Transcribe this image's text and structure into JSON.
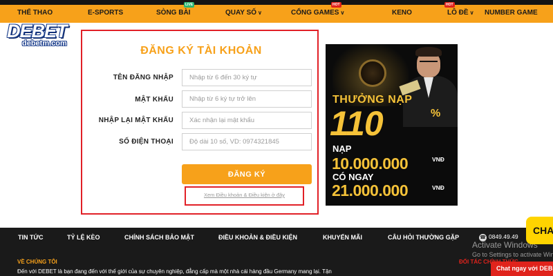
{
  "nav": {
    "items": [
      {
        "label": "THỂ THAO"
      },
      {
        "label": "E-SPORTS"
      },
      {
        "label": "SÒNG BÀI",
        "badge": "LIVE"
      },
      {
        "label": "QUAY SỐ",
        "caret": "∨"
      },
      {
        "label": "CỔNG GAMES",
        "badge": "HOT",
        "caret": "∨"
      },
      {
        "label": "KENO"
      },
      {
        "label": "LÔ ĐỀ",
        "badge": "HOT",
        "caret": "∨"
      },
      {
        "label": "NUMBER GAME"
      }
    ]
  },
  "logo": {
    "main": "DEBET",
    "sub": "debetm.com"
  },
  "form": {
    "title": "ĐĂNG KÝ TÀI KHOẢN",
    "fields": [
      {
        "label": "TÊN ĐĂNG NHẬP",
        "placeholder": "Nhập từ 6 đến 30 ký tự",
        "value": ""
      },
      {
        "label": "MẬT KHẨU",
        "placeholder": "Nhập từ 6 ký tự trở lên",
        "value": ""
      },
      {
        "label": "NHẬP LẠI MẬT KHẨU",
        "placeholder": "Xác nhận lại mật khẩu",
        "value": ""
      },
      {
        "label": "SỐ ĐIỆN THOẠI",
        "placeholder": "Độ dài 10 số, VD: 0974321845",
        "value": ""
      }
    ],
    "submit_label": "ĐĂNG KÝ",
    "terms_link": "Xem Điều khoản & Điều kiện ở đây"
  },
  "promo": {
    "line1": "THƯỞNG NẠP",
    "big": "110",
    "percent": "%",
    "deposit_label": "NẠP",
    "deposit_amount": "10.000.000",
    "currency": "VNĐ",
    "bonus_label": "CÓ NGAY",
    "bonus_amount": "21.000.000"
  },
  "footer": {
    "links": [
      "TIN TỨC",
      "TỶ LỆ KÈO",
      "CHÍNH SÁCH BẢO MẬT",
      "ĐIỀU KHOẢN & ĐIỀU KIỆN",
      "KHUYẾN MÃI",
      "CÂU HỎI THƯỜNG GẶP"
    ],
    "phone": "0849.49.49",
    "about_heading": "VỀ CHÚNG TÔI",
    "about_text": "Đến với DEBET là bạn đang đến với thế giới của sự chuyên nghiệp, đẳng cấp mà một nhà cái hàng đầu Germany mang lại. Tận",
    "partner_heading": "ĐỐI TÁC CHÍNH THỨC"
  },
  "overlay": {
    "activate_title": "Activate Windows",
    "activate_sub": "Go to Settings to activate Windows.",
    "chat_badge": "CHA",
    "chat_bar": "Chat ngay với DEBET"
  },
  "colors": {
    "accent": "#f7a11a",
    "highlight": "#e11f26",
    "footer_bg": "#1a1a1a",
    "promo_gold": "#f5c238"
  }
}
